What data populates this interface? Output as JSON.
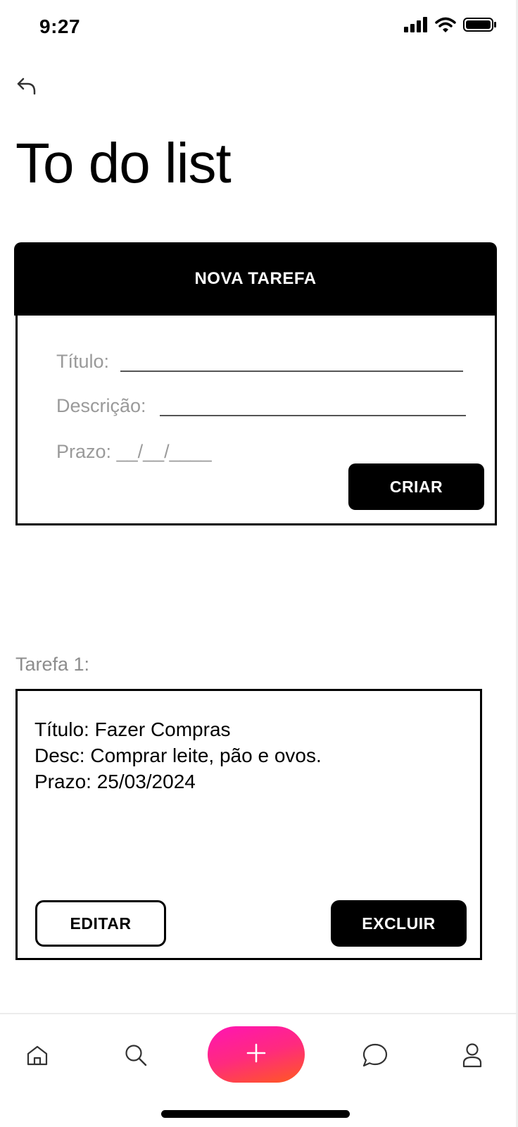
{
  "status_bar": {
    "time": "9:27",
    "icons": [
      "signal-icon",
      "wifi-icon",
      "battery-icon"
    ]
  },
  "header": {
    "back_icon": "undo-arrow-icon",
    "title": "To do list"
  },
  "new_task": {
    "header_label": "NOVA TAREFA",
    "fields": {
      "title_label": "Título:",
      "description_label": "Descrição:",
      "deadline_label": "Prazo:",
      "deadline_placeholder": "__/__/____"
    },
    "create_label": "CRIAR"
  },
  "task_list": [
    {
      "label": "Tarefa 1:",
      "title_line": "Título: Fazer Compras",
      "desc_line": "Desc: Comprar leite, pão e ovos.",
      "deadline_line": "Prazo: 25/03/2024",
      "edit_label": "EDITAR",
      "delete_label": "EXCLUIR"
    }
  ],
  "bottom_nav": {
    "items": [
      "home-icon",
      "search-icon",
      "add-icon",
      "chat-icon",
      "profile-icon"
    ]
  },
  "colors": {
    "primary": "#000000",
    "muted_text": "#9a9a9a",
    "fab_gradient_start": "#ff14b4",
    "fab_gradient_end": "#ff5a1e"
  }
}
